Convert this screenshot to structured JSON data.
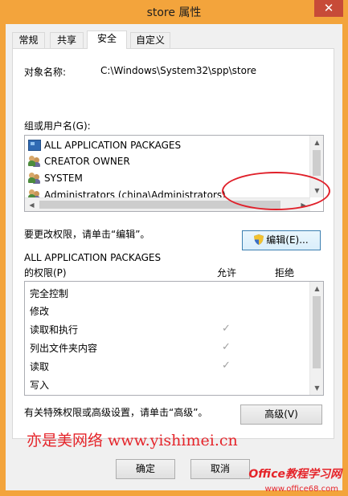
{
  "window": {
    "title": "store 属性",
    "close_glyph": "✕"
  },
  "tabs": [
    {
      "label": "常规"
    },
    {
      "label": "共享"
    },
    {
      "label": "安全"
    },
    {
      "label": "自定义"
    }
  ],
  "object": {
    "label": "对象名称:",
    "value": "C:\\Windows\\System32\\spp\\store"
  },
  "users": {
    "label": "组或用户名(G):",
    "items": [
      {
        "label": "ALL APPLICATION PACKAGES",
        "icon": "package-icon"
      },
      {
        "label": "CREATOR OWNER",
        "icon": "users-icon"
      },
      {
        "label": "SYSTEM",
        "icon": "users-icon"
      },
      {
        "label": "Administrators (china\\Administrators)",
        "icon": "users-icon"
      }
    ]
  },
  "change_hint": "要更改权限，请单击“编辑”。",
  "edit_button": "编辑(E)...",
  "permissions": {
    "subject": "ALL APPLICATION PACKAGES",
    "label": "的权限(P)",
    "allow_header": "允许",
    "deny_header": "拒绝",
    "rows": [
      {
        "name": "完全控制",
        "allow": false
      },
      {
        "name": "修改",
        "allow": false
      },
      {
        "name": "读取和执行",
        "allow": true
      },
      {
        "name": "列出文件夹内容",
        "allow": true
      },
      {
        "name": "读取",
        "allow": true
      },
      {
        "name": "写入",
        "allow": false
      }
    ]
  },
  "advanced_hint": "有关特殊权限或高级设置，请单击“高级”。",
  "advanced_button": "高级(V)",
  "watermark": {
    "line1": "亦是美网络 www.yishimei.cn",
    "site_name": "Office教程学习网",
    "site_url": "www.office68.com"
  },
  "footer": {
    "ok": "确定",
    "cancel": "取消"
  },
  "colors": {
    "frame": "#f3a43c",
    "close": "#c74b38",
    "annotation": "#e0202a"
  }
}
